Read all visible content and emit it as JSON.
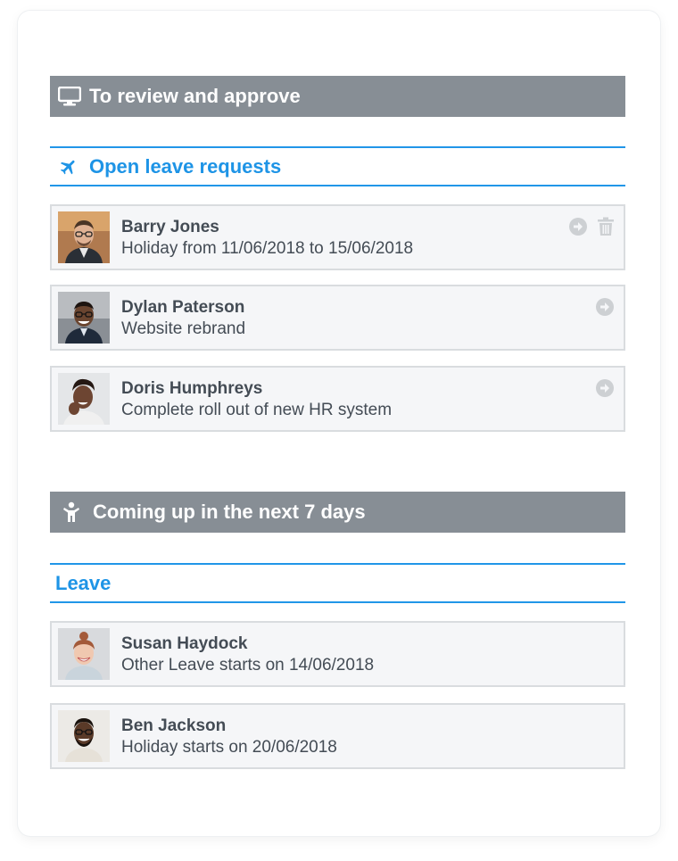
{
  "review": {
    "title": "To review and approve",
    "icon": "monitor-icon"
  },
  "open_requests": {
    "title": "Open leave requests",
    "icon": "airplane-icon",
    "items": [
      {
        "name": "Barry Jones",
        "description": "Holiday from 11/06/2018 to 15/06/2018",
        "actions": [
          "arrow-right-circle-icon",
          "trash-icon"
        ]
      },
      {
        "name": "Dylan Paterson",
        "description": "Website rebrand",
        "actions": [
          "arrow-right-circle-icon"
        ]
      },
      {
        "name": "Doris Humphreys",
        "description": "Complete roll out of new HR system",
        "actions": [
          "arrow-right-circle-icon"
        ]
      }
    ]
  },
  "upcoming": {
    "title": "Coming up in the next 7 days",
    "icon": "person-icon"
  },
  "leave": {
    "title": "Leave",
    "items": [
      {
        "name": "Susan Haydock",
        "description": "Other Leave starts on 14/06/2018"
      },
      {
        "name": "Ben Jackson",
        "description": "Holiday starts on 20/06/2018"
      }
    ]
  },
  "colors": {
    "header_bg": "#878e95",
    "accent_blue": "#1e94e6",
    "item_bg": "#f5f6f8",
    "item_border": "#d9dcdf",
    "text": "#444c55",
    "action_icon": "#cdd0d3"
  }
}
